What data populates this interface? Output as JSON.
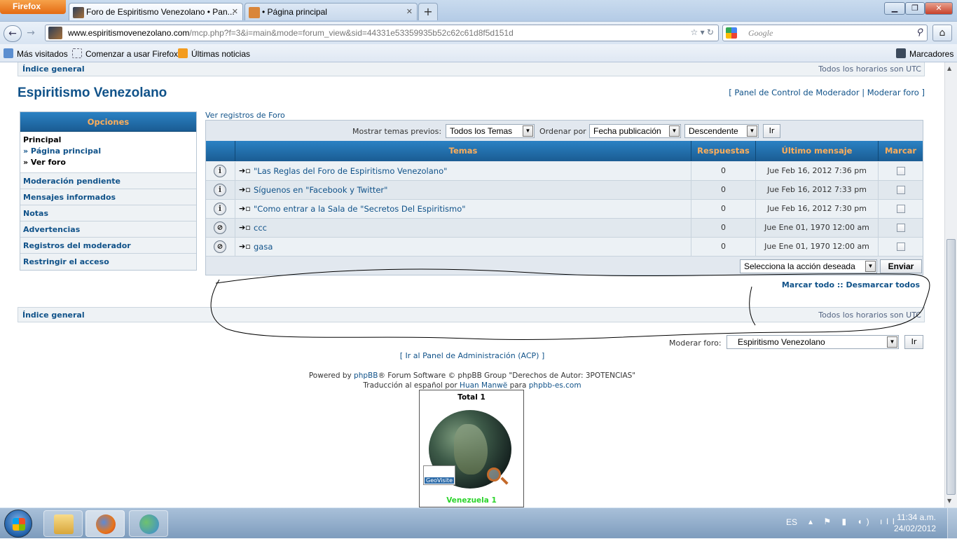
{
  "browser": {
    "app_button": "Firefox",
    "tabs": [
      {
        "title": "Foro de Espiritismo Venezolano • Pan...",
        "active": true
      },
      {
        "title": "• Página principal",
        "active": false
      }
    ],
    "new_tab_glyph": "+",
    "url_domain": "www.espiritismovenezolano.com",
    "url_path": "/mcp.php?f=3&i=main&mode=forum_view&sid=44331e53359935b52c62c61d8f5d151d",
    "search_placeholder": "Google",
    "bookmarks": [
      "Más visitados",
      "Comenzar a usar Firefox",
      "Últimas noticias"
    ],
    "bookmarks_menu": "Marcadores"
  },
  "forum": {
    "index_link": "Índice general",
    "timezone_note": "Todos los horarios son UTC",
    "title": "Espiritismo Venezolano",
    "mod_links": {
      "open": "[ ",
      "panel": "Panel de Control de Moderador",
      "sep": " | ",
      "moderate": "Moderar foro",
      "close": " ]"
    },
    "menu": {
      "header": "Opciones",
      "principal_heading": "Principal",
      "principal_items": [
        "» Página principal",
        "» Ver foro"
      ],
      "items": [
        "Moderación pendiente",
        "Mensajes informados",
        "Notas",
        "Advertencias",
        "Registros del moderador",
        "Restringir el acceso"
      ]
    },
    "logs_link": "Ver registros de Foro",
    "filters": {
      "show_label": "Mostrar temas previos:",
      "show_value": "Todos los Temas",
      "sort_label": "Ordenar por",
      "sort_value": "Fecha publicación",
      "order_value": "Descendente",
      "go_button": "Ir"
    },
    "table": {
      "headers": [
        "Temas",
        "Respuestas",
        "Último mensaje",
        "Marcar"
      ],
      "rows": [
        {
          "icon": "announcement-icon",
          "title": "\"Las Reglas del Foro de Espiritismo Venezolano\"",
          "replies": "0",
          "last": "Jue Feb 16, 2012 7:36 pm"
        },
        {
          "icon": "announcement-locked-icon",
          "title": "Síguenos en \"Facebook y Twitter\"",
          "replies": "0",
          "last": "Jue Feb 16, 2012 7:33 pm"
        },
        {
          "icon": "announcement-locked-icon",
          "title": "\"Como entrar a la Sala de \"Secretos Del Espiritismo\"",
          "replies": "0",
          "last": "Jue Feb 16, 2012 7:30 pm"
        },
        {
          "icon": "topic-moved-icon",
          "title": "ccc",
          "replies": "0",
          "last": "Jue Ene 01, 1970 12:00 am"
        },
        {
          "icon": "topic-moved-icon",
          "title": "gasa",
          "replies": "0",
          "last": "Jue Ene 01, 1970 12:00 am"
        }
      ]
    },
    "action_select": "Selecciona la acción deseada",
    "action_button": "Enviar",
    "mark_all": "Marcar todo",
    "mark_sep": " :: ",
    "unmark_all": "Desmarcar todos",
    "moderate_forum_label": "Moderar foro:",
    "moderate_forum_value": "Espiritismo Venezolano",
    "moderate_go": "Ir",
    "acp_link": "[ Ir al Panel de Administración (ACP) ]",
    "footer": {
      "powered_prefix": "Powered by ",
      "phpbb": "phpBB",
      "powered_suffix": "® Forum Software © phpBB Group \"Derechos de Autor: 3POTENCIAS\"",
      "translation_prefix": "Traducción al español por ",
      "translator": "Huan Manwë",
      "para": " para ",
      "phpbb_es": "phpbb-es.com"
    },
    "geovisite": {
      "total": "Total 1",
      "country": "Venezuela 1",
      "logo_text": "GeoVisite"
    }
  },
  "taskbar": {
    "lang": "ES",
    "time": "11:34 a.m.",
    "date": "24/02/2012"
  },
  "colors": {
    "link": "#105289",
    "header_bg": "#1a5c93",
    "header_text": "#ffae5a",
    "geo_country": "#2bd42b"
  }
}
